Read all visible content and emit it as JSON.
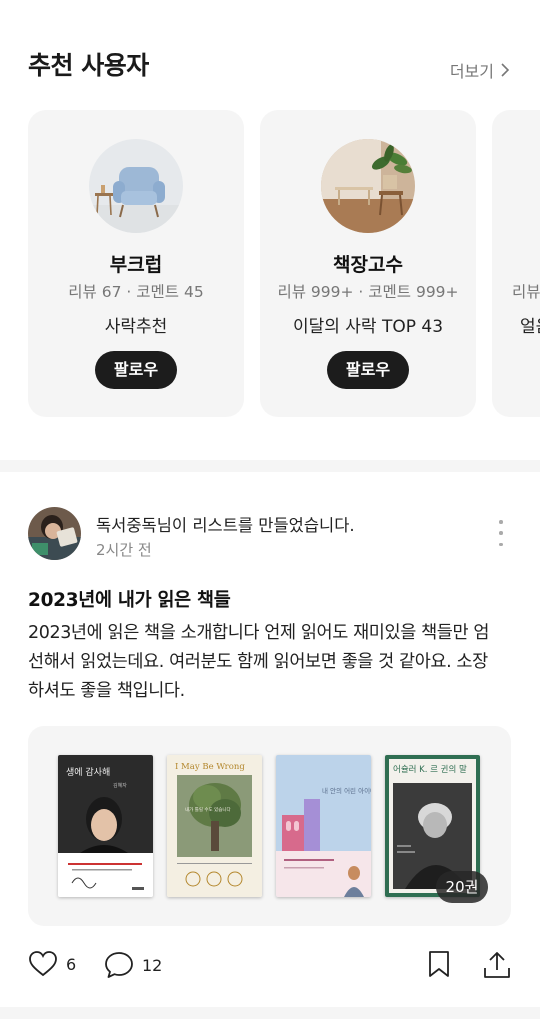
{
  "recommended": {
    "title": "추천 사용자",
    "more_label": "더보기",
    "users": [
      {
        "name": "부크럽",
        "stats": "리뷰 67 · 코멘트 45",
        "badge": "사락추천",
        "follow_label": "팔로우"
      },
      {
        "name": "책장고수",
        "stats": "리뷰 999+ · 코멘트 999+",
        "badge": "이달의 사락 TOP 43",
        "follow_label": "팔로우"
      },
      {
        "name": "",
        "stats": "리뷰",
        "badge": "얼음",
        "follow_label": ""
      }
    ]
  },
  "feed_post": {
    "author": "독서중독",
    "activity_suffix": "님이 리스트를 만들었습니다.",
    "time": "2시간 전",
    "title": "2023년에 내가 읽은 책들",
    "body": "2023년에 읽은 책을 소개합니다 언제 읽어도 재미있을 책들만 엄선해서 읽었는데요. 여러분도 함께 읽어보면 좋을 것 같아요. 소장하셔도 좋을 책입니다.",
    "books": [
      {
        "title": "생에 감사해",
        "author": "김혜자"
      },
      {
        "title": "I May Be Wrong",
        "subtitle": "내가 틀릴 수도 있습니다"
      },
      {
        "title": "내 안의 어린 아이에게",
        "subtitle": ""
      },
      {
        "title": "어슐러 K. 르 귄의 말",
        "subtitle": ""
      }
    ],
    "book_count": "20권",
    "likes": "6",
    "comments": "12"
  },
  "colors": {
    "button_bg": "#1c1c1c",
    "card_bg": "#f5f5f5",
    "muted_text": "#777777"
  }
}
